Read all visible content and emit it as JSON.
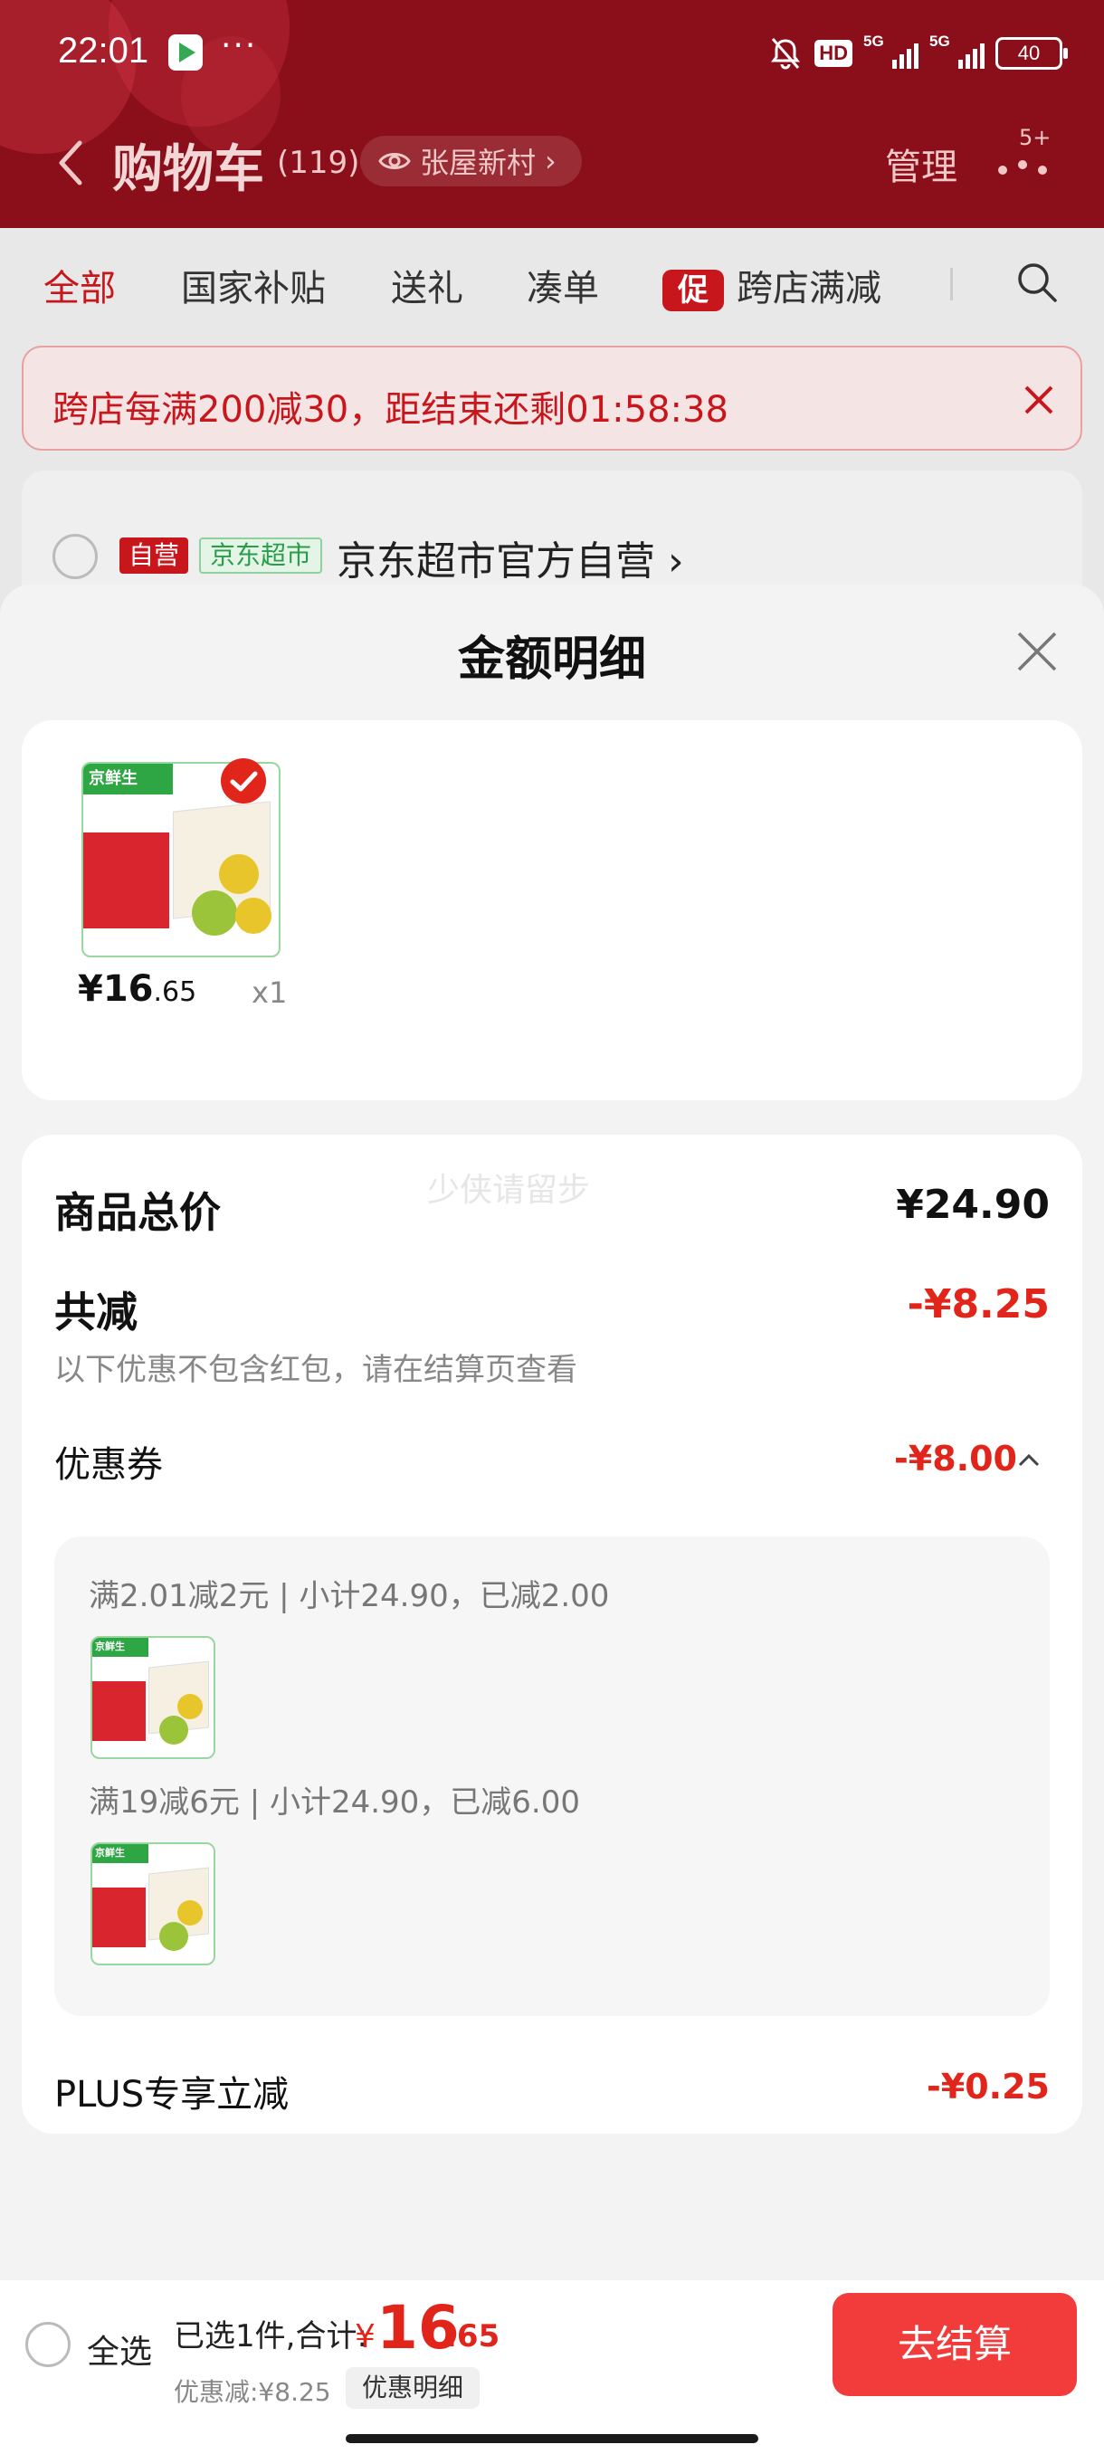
{
  "status_bar": {
    "time": "22:01",
    "more": "···",
    "hd": "HD",
    "signal1": "5G",
    "signal2": "5G",
    "battery": "40"
  },
  "nav": {
    "title": "购物车",
    "count": "(119)",
    "location": "张屋新村",
    "location_chevron": "›",
    "manage": "管理",
    "badge": "5+"
  },
  "tabs": [
    {
      "label": "全部",
      "active": true
    },
    {
      "label": "国家补贴"
    },
    {
      "label": "送礼"
    },
    {
      "label": "凑单"
    },
    {
      "label": "跨店满减",
      "tag": "促"
    }
  ],
  "notice": {
    "text": "跨店每满200减30，距结束还剩01:58:38"
  },
  "store": {
    "tag_self": "自营",
    "tag_market": "京东超市",
    "name": "京东超市官方自营",
    "chevron": "›"
  },
  "sheet": {
    "title": "金额明细",
    "product": {
      "price_int": "¥16",
      "price_dec": ".65",
      "qty": "x1",
      "thumb_tag": "京鲜生"
    },
    "watermark": "少侠请留步",
    "total_label": "商品总价",
    "total_value": "¥24.90",
    "discount_label": "共减",
    "discount_value": "-¥8.25",
    "note": "以下优惠不包含红包，请在结算页查看",
    "coupon_label": "优惠券",
    "coupon_value": "-¥8.00",
    "coupon_rules": [
      {
        "text": "满2.01减2元 | 小计24.90，已减2.00"
      },
      {
        "text": "满19减6元 | 小计24.90，已减6.00"
      }
    ],
    "plus_label": "PLUS专享立减",
    "plus_value": "-¥0.25"
  },
  "bottom": {
    "select_all": "全选",
    "summary": "已选1件,合计:",
    "currency": "¥",
    "total_int": "16",
    "total_dec": ".65",
    "saved": "优惠减:¥8.25",
    "detail_button": "优惠明细",
    "checkout": "去结算"
  },
  "colors": {
    "header_bg": "#8b0f1a",
    "accent_red": "#e1251b",
    "checkout_bg": "#f23b3b"
  }
}
